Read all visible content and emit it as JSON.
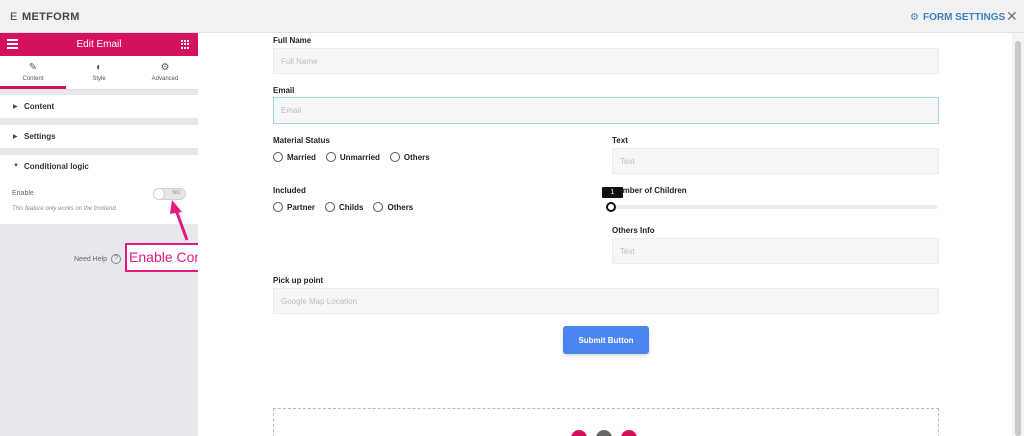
{
  "topbar": {
    "logo_glyph": "E",
    "app_title": "METFORM",
    "settings_label": "FORM SETTINGS",
    "close_glyph": "✕"
  },
  "panel": {
    "title": "Edit Email",
    "tabs": [
      {
        "label": "Content",
        "icon": "pencil-icon",
        "glyph": "✎"
      },
      {
        "label": "Style",
        "icon": "contrast-icon",
        "glyph": "◐"
      },
      {
        "label": "Advanced",
        "icon": "gear-icon",
        "glyph": "⚙"
      }
    ],
    "sections": [
      {
        "label": "Content"
      },
      {
        "label": "Settings"
      },
      {
        "label": "Conditional logic"
      }
    ],
    "enable_label": "Enable",
    "toggle_text": "NO",
    "note": "This feature only works on the frontend.",
    "need_help": "Need Help",
    "annotation": "Enable Conditional Logic"
  },
  "form": {
    "full_name": {
      "label": "Full Name",
      "placeholder": "Full Name"
    },
    "email": {
      "label": "Email",
      "placeholder": "Email"
    },
    "material_status": {
      "label": "Material Status",
      "options": [
        "Married",
        "Unmarried",
        "Others"
      ]
    },
    "text1": {
      "label": "Text",
      "placeholder": "Text"
    },
    "included": {
      "label": "Included",
      "options": [
        "Partner",
        "Childs",
        "Others"
      ]
    },
    "children": {
      "label": "Number of Children",
      "value": "1"
    },
    "others_info": {
      "label": "Others Info",
      "placeholder": "Text"
    },
    "pickup": {
      "label": "Pick up point",
      "placeholder": "Google Map Location"
    },
    "submit_label": "Submit Button"
  },
  "colors": {
    "brand": "#d5105c",
    "accent": "#4a86f0",
    "annotation": "#e01a82"
  }
}
